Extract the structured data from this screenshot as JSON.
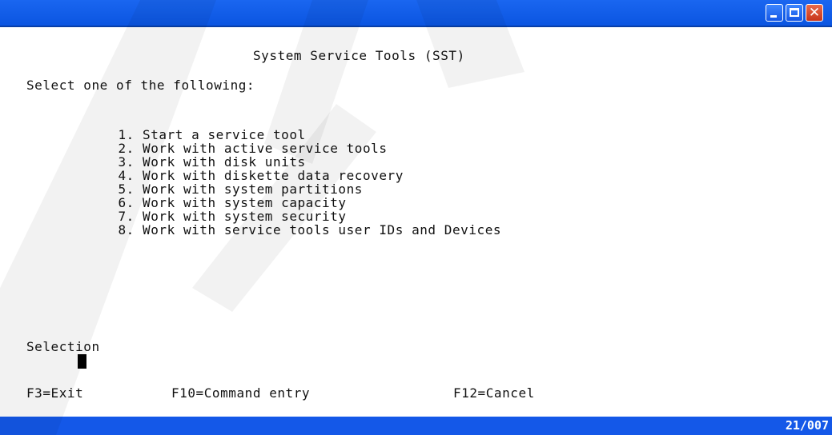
{
  "screen": {
    "title": "System Service Tools (SST)",
    "instruction": "Select one of the following:",
    "menu_items": [
      {
        "number": "1.",
        "label": "Start a service tool"
      },
      {
        "number": "2.",
        "label": "Work with active service tools"
      },
      {
        "number": "3.",
        "label": "Work with disk units"
      },
      {
        "number": "4.",
        "label": "Work with diskette data recovery"
      },
      {
        "number": "5.",
        "label": "Work with system partitions"
      },
      {
        "number": "6.",
        "label": "Work with system capacity"
      },
      {
        "number": "7.",
        "label": "Work with system security"
      },
      {
        "number": "8.",
        "label": "Work with service tools user IDs and Devices"
      }
    ],
    "selection_label": "Selection",
    "selection_value": ""
  },
  "function_keys": {
    "f3": "F3=Exit",
    "f10": "F10=Command entry",
    "f12": "F12=Cancel"
  },
  "status": {
    "cursor_position": "21/007"
  },
  "window_controls": {
    "minimize_icon": "minimize-icon",
    "maximize_icon": "maximize-icon",
    "close_icon": "close-icon",
    "close_glyph": "✕"
  },
  "colors": {
    "titlebar": "#0a54e0",
    "statusbar": "#1458e8",
    "close_button": "#c7341a",
    "screen_text": "#111111"
  }
}
